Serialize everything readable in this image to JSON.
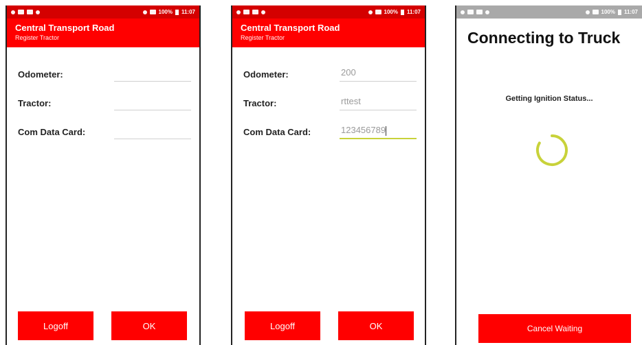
{
  "statusbar": {
    "battery": "100%",
    "time": "11:07"
  },
  "app": {
    "title": "Central Transport Road",
    "subtitle": "Register Tractor"
  },
  "form_labels": {
    "odometer": "Odometer:",
    "tractor": "Tractor:",
    "com_data_card": "Com Data Card:"
  },
  "screen_empty": {
    "odometer": "",
    "tractor": "",
    "com_data_card": ""
  },
  "screen_filled": {
    "odometer": "200",
    "tractor": "rttest",
    "com_data_card": "123456789"
  },
  "buttons": {
    "logoff": "Logoff",
    "ok": "OK",
    "cancel_waiting": "Cancel Waiting"
  },
  "connecting": {
    "title": "Connecting to Truck",
    "status": "Getting Ignition Status..."
  },
  "colors": {
    "header_red": "#ff0000",
    "status_red": "#d40000",
    "spinner": "#c8d23a",
    "active_underline": "#c8d23a"
  }
}
